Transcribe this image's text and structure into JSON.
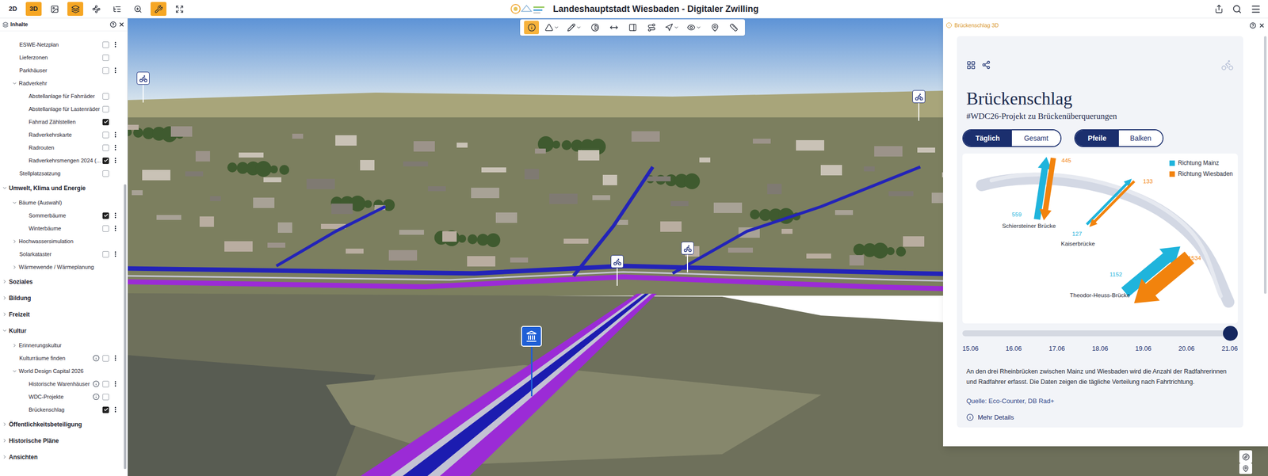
{
  "topbar": {
    "title": "Landeshauptstadt Wiesbaden - Digitaler Zwilling",
    "modes": [
      {
        "label": "2D",
        "selected": false
      },
      {
        "label": "3D",
        "selected": true
      }
    ],
    "tools": [
      {
        "selected": false
      },
      {
        "selected": true
      },
      {
        "selected": false
      },
      {
        "selected": false
      },
      {
        "selected": false
      },
      {
        "selected": true
      },
      {
        "selected": false
      }
    ]
  },
  "map_toolbar": [
    {
      "selected": true,
      "dropdown": false
    },
    {
      "selected": false,
      "dropdown": true
    },
    {
      "selected": false,
      "dropdown": true
    },
    {
      "selected": false,
      "dropdown": false
    },
    {
      "selected": false,
      "dropdown": false
    },
    {
      "selected": false,
      "dropdown": false
    },
    {
      "selected": false,
      "dropdown": false
    },
    {
      "selected": false,
      "dropdown": true
    },
    {
      "selected": false,
      "dropdown": true
    },
    {
      "selected": false,
      "dropdown": false
    },
    {
      "selected": false,
      "dropdown": false
    }
  ],
  "layers_panel": {
    "title": "Inhalte",
    "items": [
      {
        "label": "ESWE-Netzplan",
        "kind": "layer",
        "depth": 2,
        "checked": false,
        "menu": true,
        "info": false
      },
      {
        "label": "Lieferzonen",
        "kind": "layer",
        "depth": 2,
        "checked": false,
        "menu": false,
        "info": false
      },
      {
        "label": "Parkhäuser",
        "kind": "layer",
        "depth": 2,
        "checked": false,
        "menu": true,
        "info": false
      },
      {
        "label": "Radverkehr",
        "kind": "group",
        "depth": 1,
        "expanded": true
      },
      {
        "label": "Abstellanlage für Fahrräder",
        "kind": "layer",
        "depth": 3,
        "checked": false,
        "menu": false,
        "info": false
      },
      {
        "label": "Abstellanlage für Lastenräder",
        "kind": "layer",
        "depth": 3,
        "checked": false,
        "menu": false,
        "info": false
      },
      {
        "label": "Fahrrad Zählstellen",
        "kind": "layer",
        "depth": 3,
        "checked": true,
        "menu": false,
        "info": false
      },
      {
        "label": "Radverkehrskarte",
        "kind": "layer",
        "depth": 3,
        "checked": false,
        "menu": true,
        "info": false
      },
      {
        "label": "Radrouten",
        "kind": "layer",
        "depth": 3,
        "checked": false,
        "menu": true,
        "info": false
      },
      {
        "label": "Radverkehrsmengen 2024 (...",
        "kind": "layer",
        "depth": 3,
        "checked": true,
        "menu": true,
        "info": false
      },
      {
        "label": "Stellplatzsatzung",
        "kind": "layer",
        "depth": 2,
        "checked": false,
        "menu": false,
        "info": false
      },
      {
        "label": "Umwelt, Klima und Energie",
        "kind": "group",
        "depth": 0,
        "expanded": true
      },
      {
        "label": "Bäume (Auswahl)",
        "kind": "group",
        "depth": 1,
        "expanded": true
      },
      {
        "label": "Sommerbäume",
        "kind": "layer",
        "depth": 3,
        "checked": true,
        "menu": true,
        "info": false
      },
      {
        "label": "Winterbäume",
        "kind": "layer",
        "depth": 3,
        "checked": false,
        "menu": true,
        "info": false
      },
      {
        "label": "Hochwassersimulation",
        "kind": "group",
        "depth": 1,
        "expanded": false
      },
      {
        "label": "Solarkataster",
        "kind": "layer",
        "depth": 2,
        "checked": false,
        "menu": true,
        "info": false
      },
      {
        "label": "Wärmewende / Wärmeplanung",
        "kind": "group",
        "depth": 1,
        "expanded": false
      },
      {
        "label": "Soziales",
        "kind": "group",
        "depth": 0,
        "expanded": false
      },
      {
        "label": "Bildung",
        "kind": "group",
        "depth": 0,
        "expanded": false
      },
      {
        "label": "Freizeit",
        "kind": "group",
        "depth": 0,
        "expanded": false
      },
      {
        "label": "Kultur",
        "kind": "group",
        "depth": 0,
        "expanded": true
      },
      {
        "label": "Erinnerungskultur",
        "kind": "group",
        "depth": 1,
        "expanded": false
      },
      {
        "label": "Kulturräume finden",
        "kind": "layer",
        "depth": 2,
        "checked": false,
        "menu": true,
        "info": true
      },
      {
        "label": "World Design Capital 2026",
        "kind": "group",
        "depth": 1,
        "expanded": true
      },
      {
        "label": "Historische Warenhäuser",
        "kind": "layer",
        "depth": 3,
        "checked": false,
        "menu": true,
        "info": true
      },
      {
        "label": "WDC-Projekte",
        "kind": "layer",
        "depth": 3,
        "checked": false,
        "menu": false,
        "info": true
      },
      {
        "label": "Brückenschlag",
        "kind": "layer",
        "depth": 3,
        "checked": true,
        "menu": true,
        "info": false
      },
      {
        "label": "Öffentlichkeitsbeteiligung",
        "kind": "group",
        "depth": 0,
        "expanded": false
      },
      {
        "label": "Historische Pläne",
        "kind": "group",
        "depth": 0,
        "expanded": false
      },
      {
        "label": "Ansichten",
        "kind": "group",
        "depth": 0,
        "expanded": false
      }
    ]
  },
  "detail_panel": {
    "header": "Brückenschlag 3D",
    "title": "Brückenschlag",
    "subtitle": "#WDC26-Projekt zu Brückenüberquerungen",
    "period_tabs": [
      {
        "label": "Täglich",
        "selected": true
      },
      {
        "label": "Gesamt",
        "selected": false
      }
    ],
    "view_tabs": [
      {
        "label": "Pfeile",
        "selected": true
      },
      {
        "label": "Balken",
        "selected": false
      }
    ],
    "chart": {
      "bridges": [
        "Schiersteiner Brücke",
        "Kaiserbrücke",
        "Theodor-Heuss-Brücke"
      ],
      "series": [
        {
          "name": "Richtung Mainz",
          "color": "#1fb4dc",
          "values": [
            559,
            127,
            1152
          ],
          "labels": [
            "559",
            "127",
            "1152"
          ]
        },
        {
          "name": "Richtung Wiesbaden",
          "color": "#f2830d",
          "values": [
            445,
            133,
            1534
          ],
          "labels": [
            "445",
            "133",
            "1534"
          ]
        }
      ]
    },
    "timeline": {
      "level": 1,
      "dates": [
        "15.06",
        "16.06",
        "17.06",
        "18.06",
        "19.06",
        "20.06",
        "21.06"
      ]
    },
    "description": "An den drei Rheinbrücken zwischen Mainz und Wiesbaden wird die Anzahl der Radfahrerinnen und Radfahrer erfasst. Die Daten zeigen die tägliche Verteilung nach Fahrtrichtung.",
    "source": "Quelle: Eco-Counter, DB Rad+",
    "more": "Mehr Details"
  }
}
